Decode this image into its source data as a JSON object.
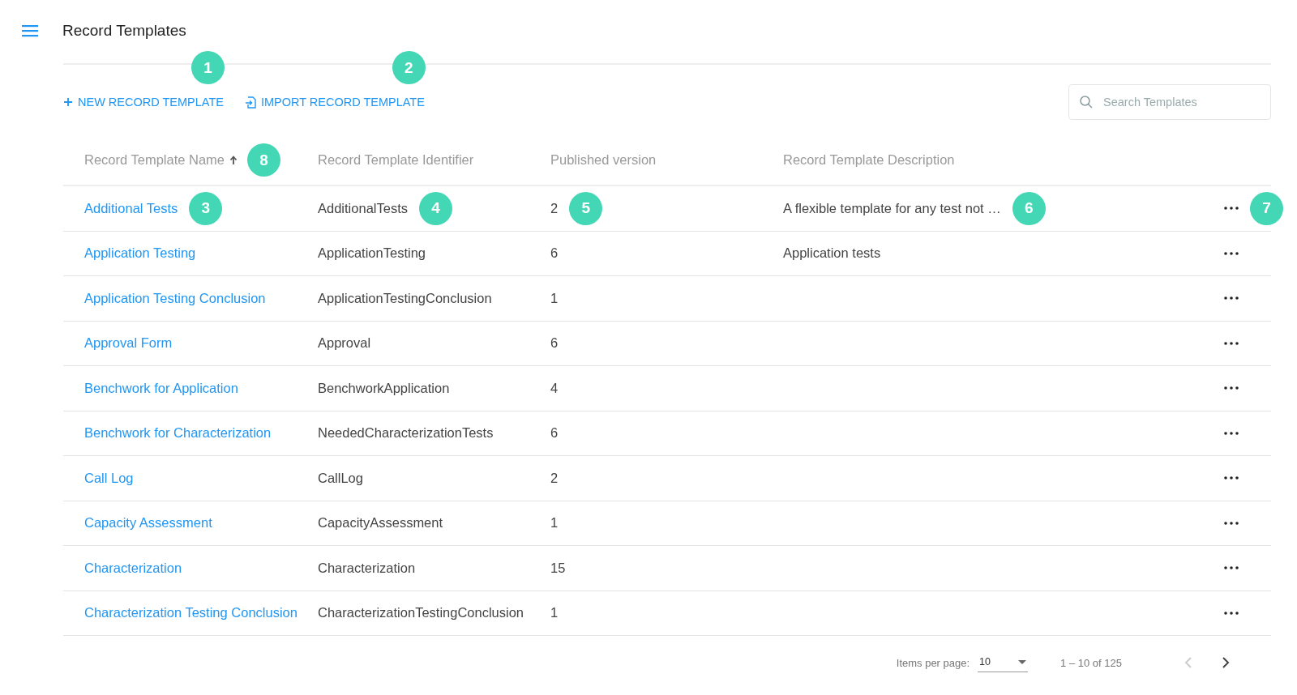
{
  "header": {
    "title": "Record Templates"
  },
  "actions": [
    {
      "kind": "new",
      "label": "NEW RECORD TEMPLATE",
      "callout": "1"
    },
    {
      "kind": "import",
      "label": "IMPORT RECORD TEMPLATE",
      "callout": "2"
    }
  ],
  "search": {
    "placeholder": "Search Templates"
  },
  "table": {
    "columns": [
      {
        "label": "Record Template Name",
        "sorted": true,
        "callout": "8"
      },
      {
        "label": "Record Template Identifier"
      },
      {
        "label": "Published version"
      },
      {
        "label": "Record Template Description"
      }
    ],
    "rows": [
      {
        "name": "Additional Tests",
        "identifier": "AdditionalTests",
        "version": "2",
        "description": "A flexible template for any test not …",
        "callouts": [
          "3",
          "4",
          "5",
          "6",
          "7"
        ]
      },
      {
        "name": "Application Testing",
        "identifier": "ApplicationTesting",
        "version": "6",
        "description": "Application tests"
      },
      {
        "name": "Application Testing Conclusion",
        "identifier": "ApplicationTestingConclusion",
        "version": "1"
      },
      {
        "name": "Approval Form",
        "identifier": "Approval",
        "version": "6"
      },
      {
        "name": "Benchwork for Application",
        "identifier": "BenchworkApplication",
        "version": "4"
      },
      {
        "name": "Benchwork for Characterization",
        "identifier": "NeededCharacterizationTests",
        "version": "6"
      },
      {
        "name": "Call Log",
        "identifier": "CallLog",
        "version": "2"
      },
      {
        "name": "Capacity Assessment",
        "identifier": "CapacityAssessment",
        "version": "1"
      },
      {
        "name": "Characterization",
        "identifier": "Characterization",
        "version": "15"
      },
      {
        "name": "Characterization Testing Conclusion",
        "identifier": "CharacterizationTestingConclusion",
        "version": "1"
      }
    ]
  },
  "paginator": {
    "label": "Items per page:",
    "page_size": "10",
    "range": "1 – 10 of 125",
    "prev_disabled": true,
    "next_disabled": false
  }
}
